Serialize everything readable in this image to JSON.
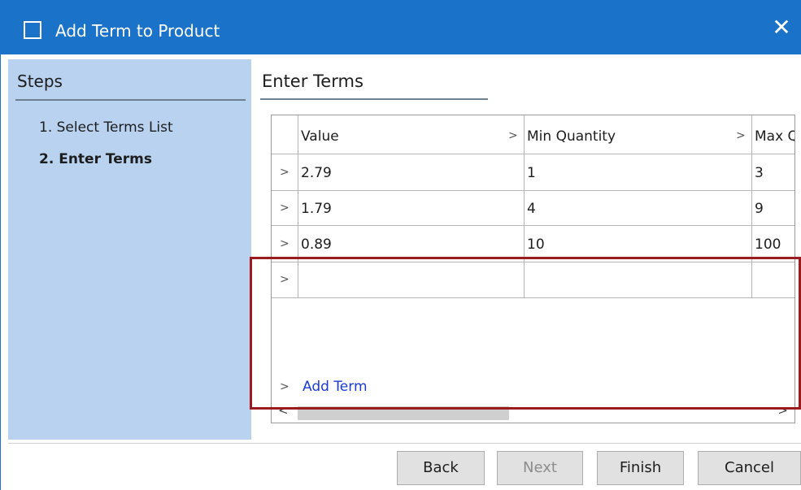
{
  "window": {
    "title": "Add Term to Product",
    "close_glyph": "✕"
  },
  "steps": {
    "title": "Steps",
    "items": [
      {
        "label": "1. Select Terms List",
        "active": false
      },
      {
        "label": "2. Enter Terms",
        "active": true
      }
    ]
  },
  "main": {
    "title": "Enter Terms"
  },
  "grid": {
    "columns": [
      "Value",
      "Min Quantity",
      "Max Q"
    ],
    "rows": [
      [
        "2.79",
        "1",
        "3"
      ],
      [
        "1.79",
        "4",
        "9"
      ],
      [
        "0.89",
        "10",
        "100"
      ],
      [
        "",
        "",
        ""
      ]
    ],
    "add_term_label": "Add Term"
  },
  "buttons": {
    "back": "Back",
    "next": "Next",
    "finish": "Finish",
    "cancel": "Cancel"
  },
  "colors": {
    "titlebar": "#1a73c9",
    "steps_panel": "#b8d2f0",
    "highlight": "#9b1b1e",
    "link": "#1a3cd6"
  }
}
